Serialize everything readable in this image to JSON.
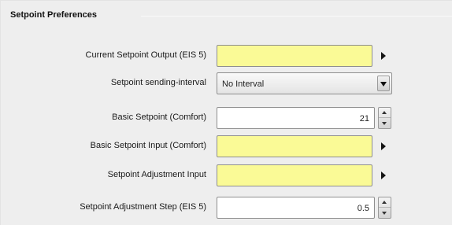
{
  "group": {
    "title": "Setpoint Preferences"
  },
  "rows": [
    {
      "label": "Current Setpoint Output (EIS 5)",
      "kind": "object-field",
      "value": ""
    },
    {
      "label": "Setpoint sending-interval",
      "kind": "dropdown",
      "value": "No Interval"
    },
    {
      "label": "Basic Setpoint (Comfort)",
      "kind": "spinner",
      "value": "21"
    },
    {
      "label": "Basic Setpoint Input (Comfort)",
      "kind": "object-field",
      "value": ""
    },
    {
      "label": "Setpoint Adjustment Input",
      "kind": "object-field",
      "value": ""
    },
    {
      "label": "Setpoint Adjustment Step (EIS 5)",
      "kind": "spinner",
      "value": "0.5"
    }
  ],
  "colors": {
    "object_field": "#fafa96",
    "background": "#eeeeee"
  },
  "icons": {
    "object_arrow": "arrow-right-icon",
    "dropdown": "chevron-down-icon",
    "spinner_up": "spinner-up-icon",
    "spinner_down": "spinner-down-icon"
  }
}
